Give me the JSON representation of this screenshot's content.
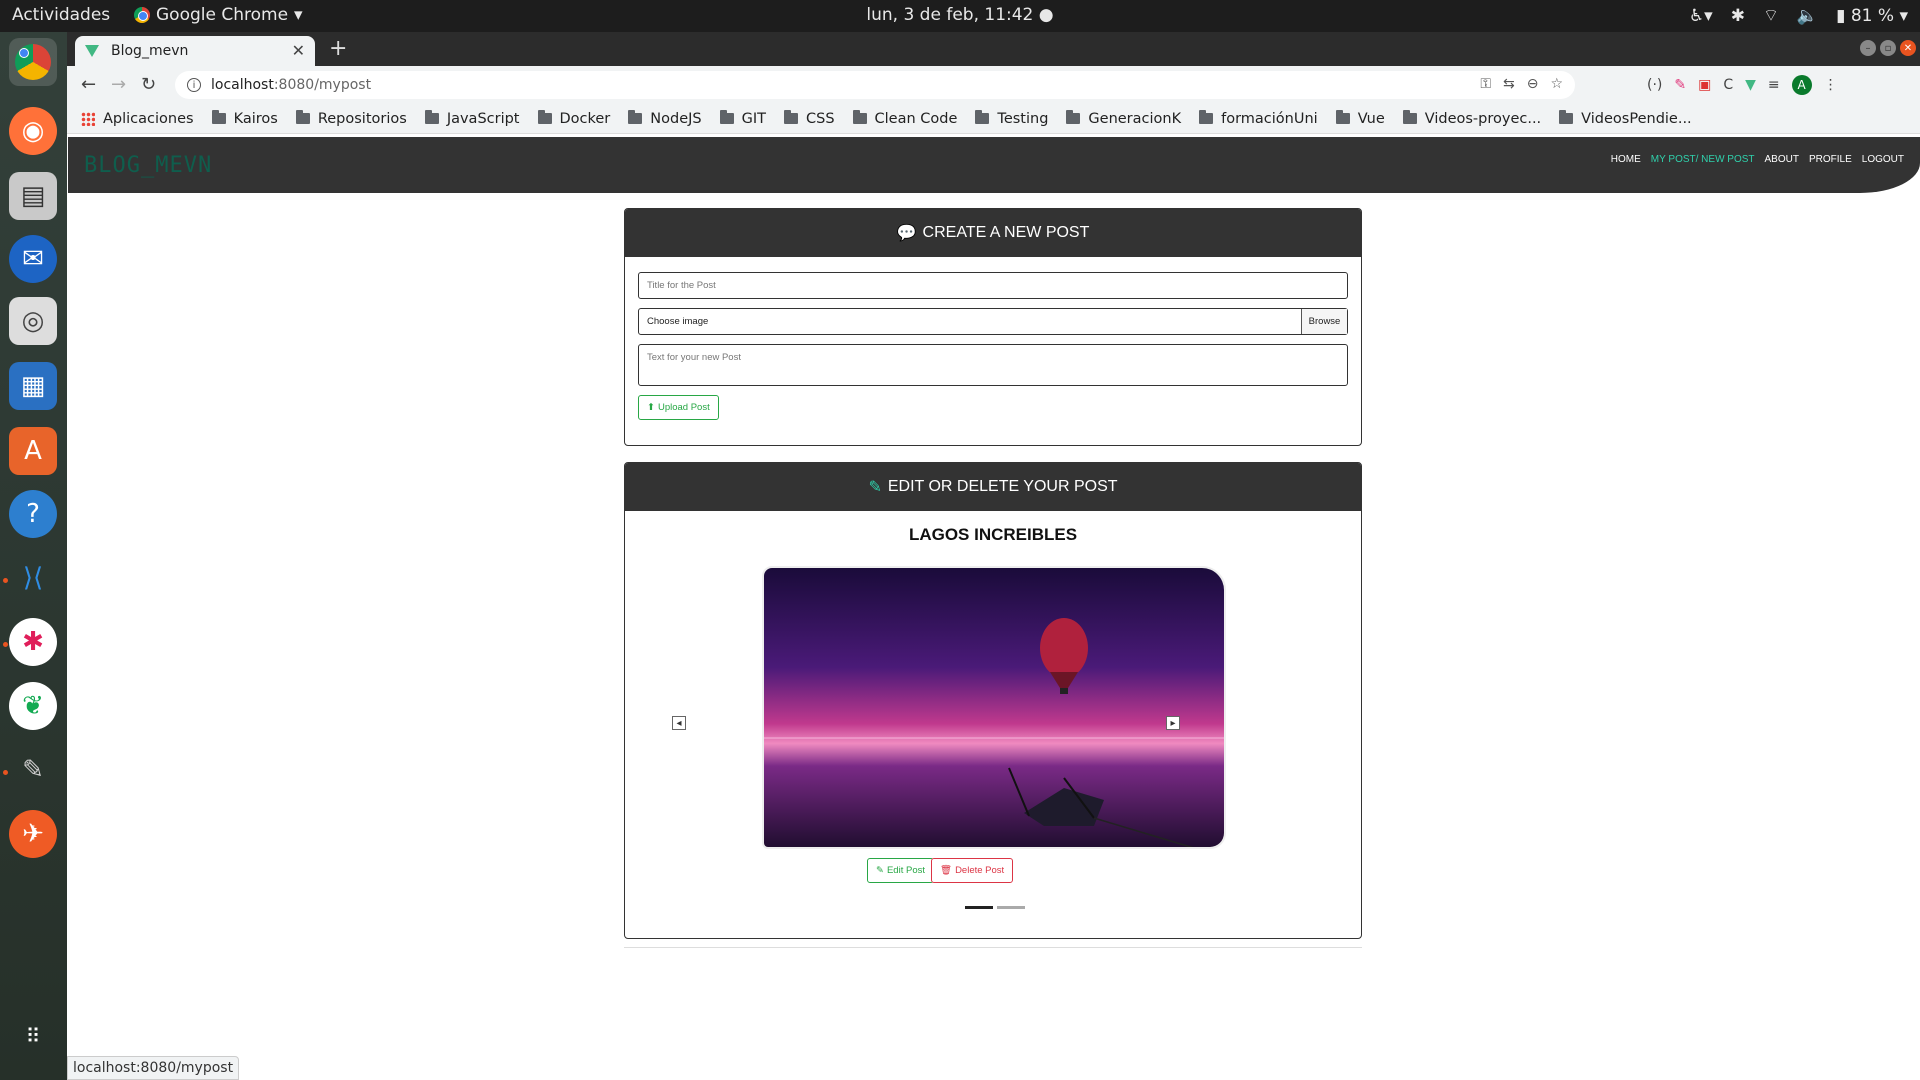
{
  "system": {
    "activities": "Actividades",
    "app_name": "Google Chrome",
    "clock": "lun,  3 de feb, 11:42 ●",
    "battery": "81 %"
  },
  "browser": {
    "tab_title": "Blog_mevn",
    "url_host": "localhost",
    "url_rest": ":8080/mypost",
    "status_url": "localhost:8080/mypost",
    "avatar_letter": "A",
    "bookmarks": [
      "Aplicaciones",
      "Kairos",
      "Repositorios",
      "JavaScript",
      "Docker",
      "NodeJS",
      "GIT",
      "CSS",
      "Clean Code",
      "Testing",
      "GeneracionK",
      "formaciónUni",
      "Vue",
      "Videos-proyec...",
      "VideosPendie..."
    ]
  },
  "site": {
    "brand": "BLOG_MEVN",
    "nav": {
      "home": "HOME",
      "mypost": "MY POST/ NEW POST",
      "about": "ABOUT",
      "profile": "PROFILE",
      "logout": "LOGOUT"
    },
    "accent_color": "#2fd0ab"
  },
  "create_post": {
    "header": "CREATE A NEW POST",
    "title_placeholder": "Title for the Post",
    "image_label": "Choose image",
    "browse_label": "Browse",
    "text_placeholder": "Text for your new Post",
    "upload_label": "Upload Post"
  },
  "edit_post": {
    "header": "EDIT OR DELETE YOUR POST",
    "post_title": "LAGOS INCREIBLES",
    "edit_label": "Edit Post",
    "delete_label": "Delete Post",
    "prev_icon": "chevron-left-icon",
    "next_icon": "chevron-right-icon"
  }
}
